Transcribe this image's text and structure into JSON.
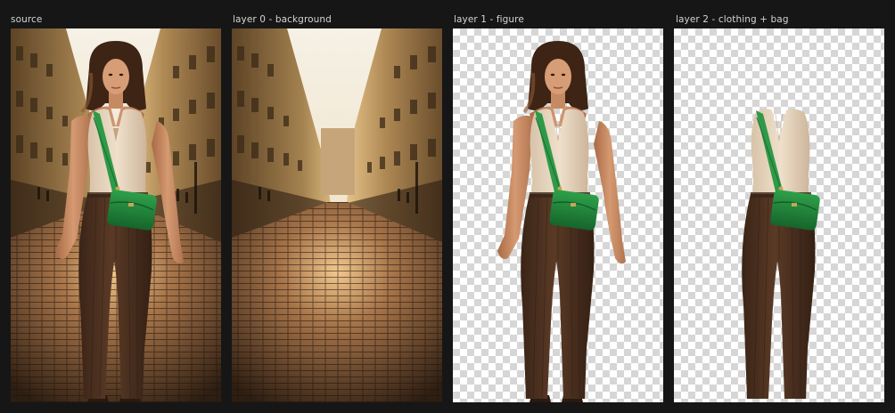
{
  "panels": [
    {
      "label": "source"
    },
    {
      "label": "layer 0 - background"
    },
    {
      "label": "layer 1 - figure"
    },
    {
      "label": "layer 2 - clothing + bag"
    }
  ],
  "colors": {
    "window_bg": "#161616",
    "label_text": "#d4d4d4",
    "checker_dark": "#d6d6d6",
    "checker_light": "#ffffff",
    "sky": "#f3ecdf",
    "building": "#9a7a52",
    "cobblestone": "#6b4a2e",
    "top": "#e7d6c2",
    "trousers": "#4e3222",
    "bag": "#23873a",
    "strap": "#2e9a48",
    "skin": "#c98a62",
    "hair": "#4a2c1a"
  },
  "icons": {
    "transparency": "checkerboard-pattern"
  }
}
